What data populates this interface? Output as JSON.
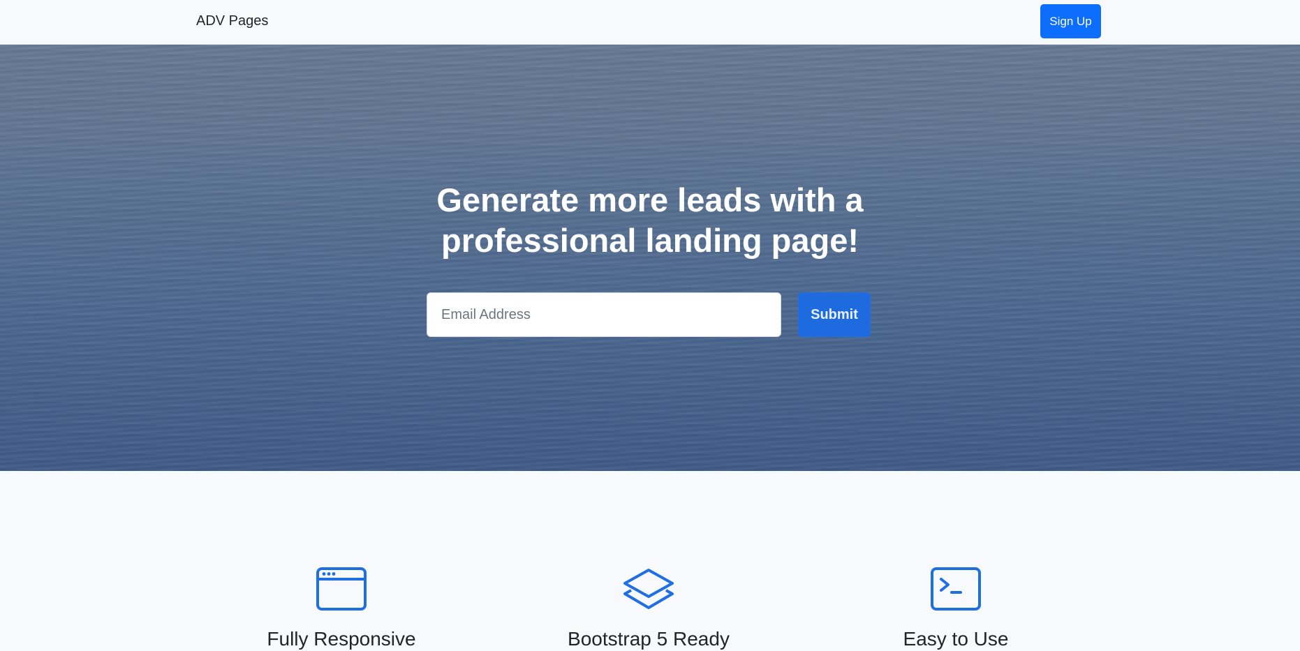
{
  "navbar": {
    "brand": "ADV Pages",
    "signup_label": "Sign Up"
  },
  "hero": {
    "title_line1": "Generate more leads with a",
    "title_line2": "professional landing page!",
    "email_placeholder": "Email Address",
    "submit_label": "Submit"
  },
  "features": [
    {
      "icon": "browser-window-icon",
      "title": "Fully Responsive"
    },
    {
      "icon": "layers-icon",
      "title": "Bootstrap 5 Ready"
    },
    {
      "icon": "terminal-icon",
      "title": "Easy to Use"
    }
  ],
  "colors": {
    "primary": "#0d6efd",
    "icon": "#1e6fe3",
    "page_bg": "#f8f9fa"
  }
}
